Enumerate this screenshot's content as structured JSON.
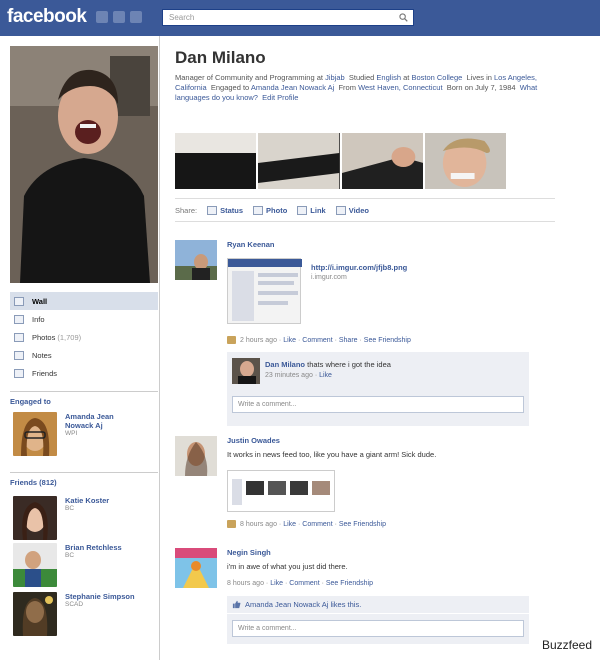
{
  "app": {
    "logo": "facebook",
    "search_placeholder": "Search"
  },
  "profile": {
    "name": "Dan Milano",
    "bio": {
      "job_prefix": "Manager of Community and Programming at ",
      "job_company": "Jibjab",
      "studied_prefix": "Studied ",
      "studied_subject": "English",
      "studied_mid": " at ",
      "studied_school": "Boston College",
      "lives_prefix": "Lives in ",
      "lives_city": "Los Angeles, California",
      "engaged_prefix": "Engaged to ",
      "engaged_to": "Amanda Jean Nowack Aj",
      "from_prefix": "From ",
      "from_city": "West Haven, Connecticut",
      "born": "Born on July 7, 1984",
      "languages_link": "What languages do you know?",
      "edit_link": "Edit Profile"
    }
  },
  "share_bar": {
    "label": "Share:",
    "options": [
      "Status",
      "Photo",
      "Link",
      "Video"
    ]
  },
  "sidebar": {
    "items": [
      {
        "label": "Wall",
        "count": ""
      },
      {
        "label": "Info",
        "count": ""
      },
      {
        "label": "Photos",
        "count": "(1,709)"
      },
      {
        "label": "Notes",
        "count": ""
      },
      {
        "label": "Friends",
        "count": ""
      }
    ],
    "engaged_heading": "Engaged to",
    "engaged_person": {
      "name": "Amanda Jean Nowack Aj",
      "sub": "WPI"
    },
    "friends_heading": "Friends (812)",
    "friends": [
      {
        "name": "Katie Koster",
        "sub": "BC"
      },
      {
        "name": "Brian Retchless",
        "sub": "BC"
      },
      {
        "name": "Stephanie Simpson",
        "sub": "SCAD"
      }
    ]
  },
  "posts": [
    {
      "author": "Ryan Keenan",
      "link_url": "http://i.imgur.com/jfjb8.png",
      "link_domain": "i.imgur.com",
      "meta_time": "2 hours ago",
      "actions": [
        "Like",
        "Comment",
        "Share",
        "See Friendship"
      ],
      "comment": {
        "author": "Dan Milano",
        "text": "thats where i got the idea",
        "time": "23 minutes ago",
        "like": "Like"
      },
      "comment_placeholder": "Write a comment..."
    },
    {
      "author": "Justin Owades",
      "message": "It works in news feed too, like you have a giant arm! Sick dude.",
      "meta_time": "8 hours ago",
      "actions": [
        "Like",
        "Comment",
        "See Friendship"
      ]
    },
    {
      "author": "Negin Singh",
      "message": "i'm in awe of what you just did there.",
      "meta_time": "8 hours ago",
      "actions": [
        "Like",
        "Comment",
        "See Friendship"
      ],
      "likes_line": "Amanda Jean Nowack Aj likes this.",
      "comment_placeholder": "Write a comment..."
    }
  ],
  "watermark": "Buzzfeed"
}
